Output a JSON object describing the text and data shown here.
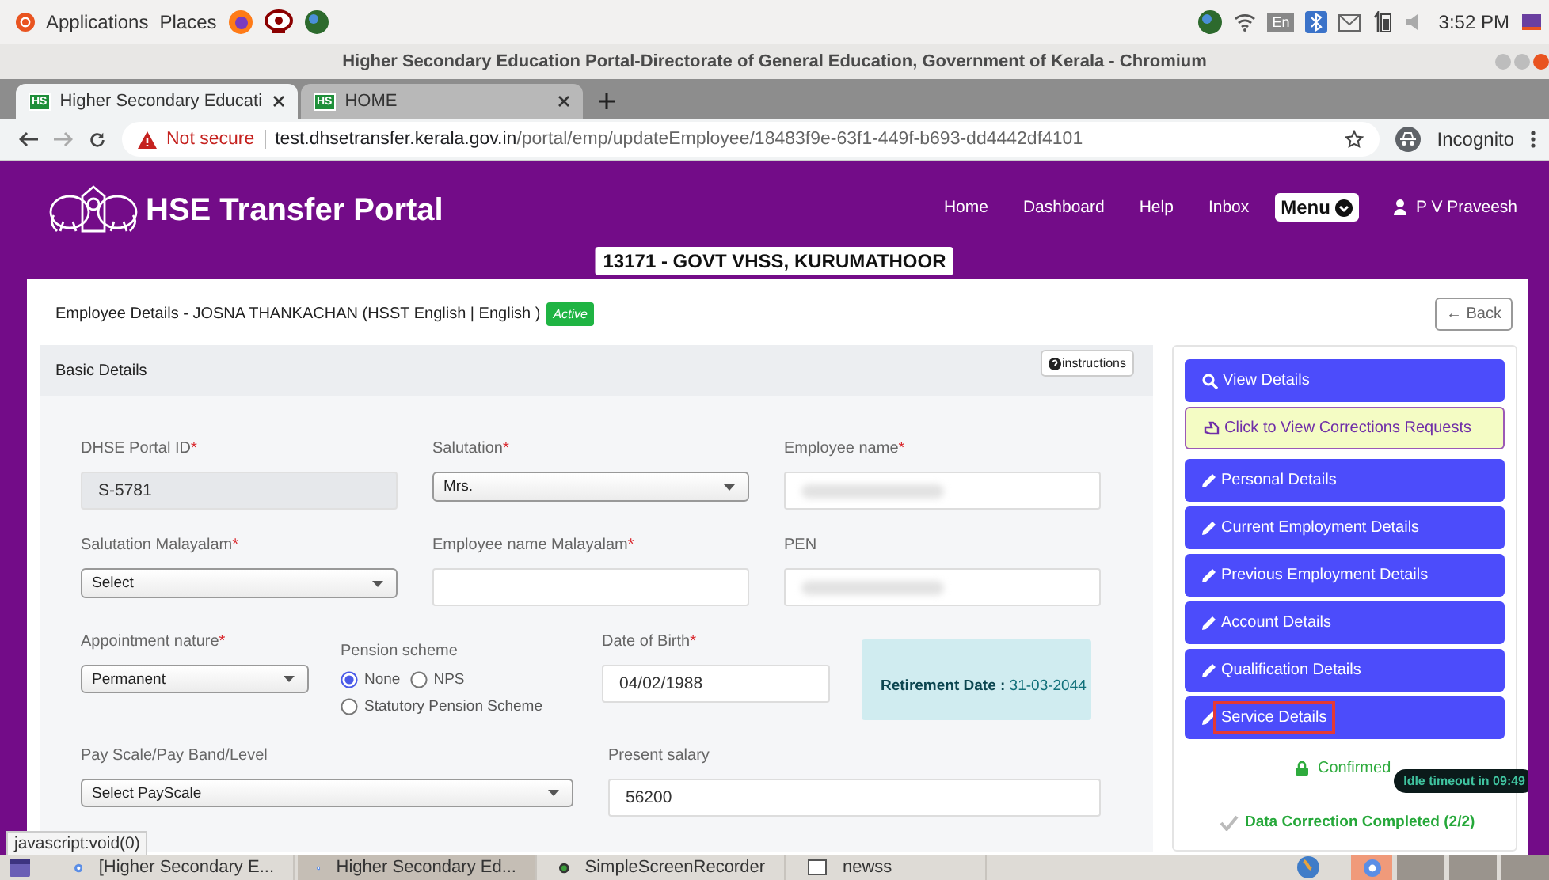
{
  "system_bar": {
    "menus": [
      {
        "label": "Applications"
      },
      {
        "label": "Places"
      }
    ],
    "keyboard": "En",
    "clock": "3:52 PM"
  },
  "window": {
    "title": "Higher Secondary Education Portal-Directorate of General Education, Government of Kerala - Chromium"
  },
  "tabs": [
    {
      "label": "Higher Secondary Educati",
      "favicon": "HS",
      "selected": true
    },
    {
      "label": "HOME",
      "favicon": "HS",
      "selected": false
    }
  ],
  "address_bar": {
    "security": "Not secure",
    "host": "test.dhsetransfer.kerala.gov.in",
    "path": "/portal/emp/updateEmployee/18483f9e-63f1-449f-b693-dd4442df4101",
    "mode": "Incognito"
  },
  "header": {
    "title": "HSE Transfer Portal",
    "nav": [
      {
        "label": "Home"
      },
      {
        "label": "Dashboard"
      },
      {
        "label": "Help"
      },
      {
        "label": "Inbox"
      }
    ],
    "menu": "Menu",
    "user": "P V Praveesh",
    "school": "13171 - GOVT VHSS, KURUMATHOOR"
  },
  "employee": {
    "heading": "Employee Details - JOSNA THANKACHAN (HSST English | English )",
    "status": "Active"
  },
  "back_button": "← Back",
  "basic_details": {
    "title": "Basic Details",
    "instructions": "instructions",
    "rows": [
      [
        {
          "label": "DHSE Portal ID",
          "required_mark": "*",
          "kind": "readonly",
          "value": "S-5781"
        },
        {
          "label": "Salutation",
          "required_mark": "*",
          "kind": "select",
          "value": "Mrs."
        },
        {
          "label": "Employee name",
          "required_mark": "*",
          "kind": "redacted"
        }
      ],
      [
        {
          "label": "Salutation Malayalam",
          "required_mark": "*",
          "kind": "select",
          "value": "Select"
        },
        {
          "label": "Employee name Malayalam",
          "required_mark": "*",
          "kind": "text"
        },
        {
          "label": "PEN",
          "kind": "redacted"
        }
      ],
      [
        {
          "label": "Appointment nature",
          "required_mark": "*",
          "kind": "select",
          "value": "Permanent"
        },
        {
          "label": "Pension scheme",
          "kind": "radio",
          "options": [
            {
              "label": "None",
              "selected": true
            },
            {
              "label": "NPS",
              "selected": false
            },
            {
              "label": "Statutory Pension Scheme",
              "selected": false
            }
          ]
        },
        {
          "label": "Date of Birth",
          "required_mark": "*",
          "kind": "text",
          "value": "04/02/1988"
        },
        {
          "kind": "info",
          "text": "**Retirement Date :** 31-03-2044"
        }
      ],
      [
        {
          "label": "Pay Scale/Pay Band/Level",
          "kind": "select",
          "value": "Select PayScale"
        },
        {
          "label": "Present salary",
          "kind": "text",
          "value": "56200"
        }
      ]
    ]
  },
  "side_menu": [
    {
      "label": "View Details",
      "kind": "view",
      "highlighted": false
    },
    {
      "label": "Click to View Corrections Requests",
      "kind": "corrections",
      "highlighted": false
    },
    {
      "label": "Personal Details",
      "kind": "edit",
      "highlighted": false
    },
    {
      "label": "Current Employment Details",
      "kind": "edit",
      "highlighted": false
    },
    {
      "label": "Previous Employment Details",
      "kind": "edit",
      "highlighted": false
    },
    {
      "label": "Account Details",
      "kind": "edit",
      "highlighted": false
    },
    {
      "label": "Qualification Details",
      "kind": "edit",
      "highlighted": false
    },
    {
      "label": "Service Details",
      "kind": "edit",
      "highlighted": true
    }
  ],
  "confirmed": "Confirmed",
  "idle_timeout": "Idle timeout in 09:49",
  "completion": "Data Correction Completed (2/2)",
  "status_tooltip": "javascript:void(0)",
  "taskbar": [
    {
      "label": "[Higher Secondary E...",
      "kind": "chrome",
      "selected": false
    },
    {
      "label": "Higher Secondary Ed...",
      "kind": "chrome",
      "selected": true
    },
    {
      "label": "SimpleScreenRecorder",
      "kind": "recorder",
      "selected": false
    },
    {
      "label": "newss",
      "kind": "window",
      "selected": false
    }
  ]
}
